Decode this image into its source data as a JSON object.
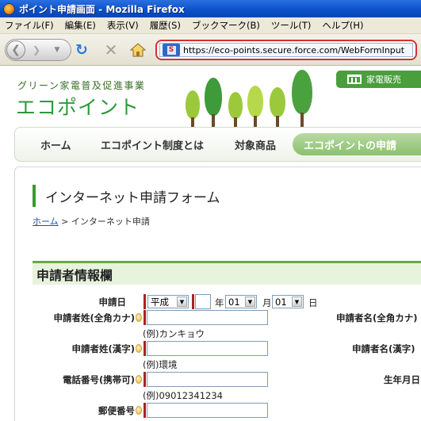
{
  "window": {
    "title": "ポイント申請画面 - Mozilla Firefox"
  },
  "menu": {
    "items": [
      "ファイル(F)",
      "編集(E)",
      "表示(V)",
      "履歴(S)",
      "ブックマーク(B)",
      "ツール(T)",
      "ヘルプ(H)"
    ]
  },
  "toolbar": {
    "url": "https://eco-points.secure.force.com/WebFormInput",
    "site_identity_letter": "S"
  },
  "site": {
    "subtitle": "グリーン家電普及促進事業",
    "logo": "エコポイント",
    "retail_label": "家電販売"
  },
  "nav": {
    "home": "ホーム",
    "system": "エコポイント制度とは",
    "products": "対象商品",
    "apply": "エコポイントの申請"
  },
  "form": {
    "title": "インターネット申請フォーム",
    "breadcrumb_home": "ホーム",
    "breadcrumb_sep": " > ",
    "breadcrumb_current": "インターネット申請",
    "section_title": "申請者情報欄",
    "application_date_label": "申請日",
    "era_value": "平成",
    "year_unit": "年",
    "month_value": "01",
    "month_unit": "月",
    "day_value": "01",
    "day_unit": "日",
    "last_name_kana_label": "申請者姓(全角カナ)",
    "last_name_kana_example": "(例)カンキョウ",
    "first_name_kana_label": "申請者名(全角カナ)",
    "last_name_kanji_label": "申請者姓(漢字)",
    "last_name_kanji_example": "(例)環境",
    "first_name_kanji_label": "申請者名(漢字)",
    "phone_label": "電話番号(携帯可)",
    "phone_example": "(例)09012341234",
    "birth_label": "生年月日",
    "postal_label": "郵便番号"
  },
  "colors": {
    "titlebar": "#0a4fc8",
    "brand_green": "#2b9a3a",
    "section_bg": "#e8f3de",
    "url_highlight": "#d83030",
    "required_marker": "#b02020"
  }
}
